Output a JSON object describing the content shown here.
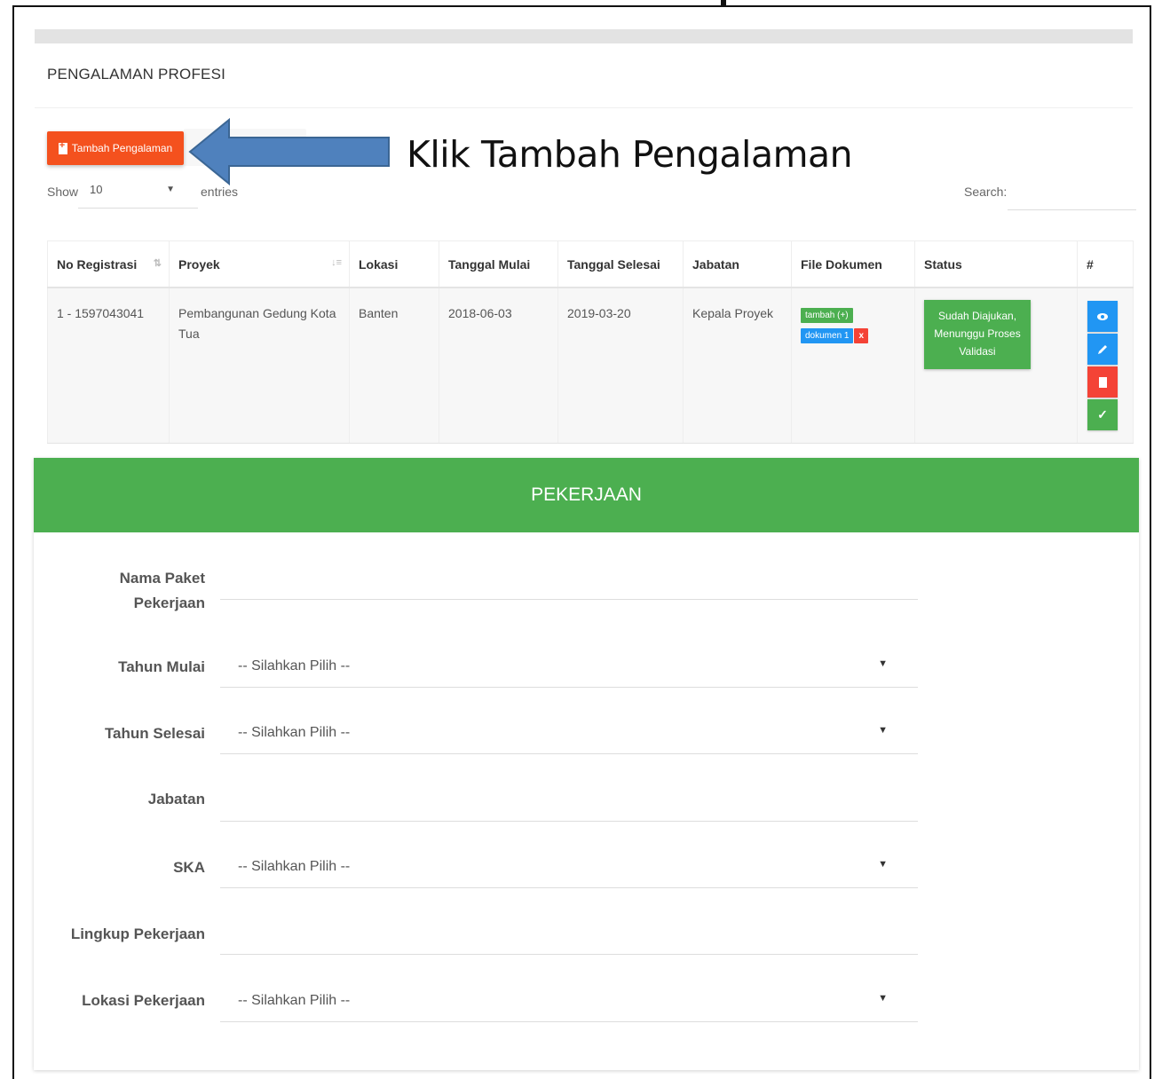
{
  "section": {
    "title": "PENGALAMAN PROFESI"
  },
  "toolbar": {
    "add_label": "Tambah Pengalaman"
  },
  "annotation": {
    "callout_text": "Klik Tambah Pengalaman",
    "arrow_color": "#4f81bd"
  },
  "table_controls": {
    "show_label": "Show",
    "show_value": "10",
    "entries_label": "entries",
    "search_label": "Search:"
  },
  "table": {
    "headers": [
      "No Registrasi",
      "Proyek",
      "Lokasi",
      "Tanggal Mulai",
      "Tanggal Selesai",
      "Jabatan",
      "File Dokumen",
      "Status",
      "#"
    ],
    "rows": [
      {
        "no_registrasi": "1 - 1597043041",
        "proyek": "Pembangunan Gedung Kota Tua",
        "lokasi": "Banten",
        "tanggal_mulai": "2018-06-03",
        "tanggal_selesai": "2019-03-20",
        "jabatan": "Kepala Proyek",
        "file_add": "tambah (+)",
        "file_doc": "dokumen 1",
        "file_remove": "x",
        "status": "Sudah Diajukan, Menunggu Proses Validasi",
        "check_glyph": "✓"
      }
    ]
  },
  "form": {
    "header": "PEKERJAAN",
    "fields": [
      {
        "label_line1": "Nama Paket",
        "label_line2": "Pekerjaan",
        "placeholder": ""
      },
      {
        "label": "Tahun Mulai",
        "placeholder": "-- Silahkan Pilih --"
      },
      {
        "label": "Tahun Selesai",
        "placeholder": "-- Silahkan Pilih --"
      },
      {
        "label": "Jabatan",
        "placeholder": ""
      },
      {
        "label": "SKA",
        "placeholder": "-- Silahkan Pilih --"
      },
      {
        "label": "Lingkup Pekerjaan",
        "placeholder": ""
      },
      {
        "label": "Lokasi Pekerjaan",
        "placeholder": "-- Silahkan Pilih --"
      }
    ]
  },
  "colors": {
    "accent_orange": "#f4511e",
    "accent_green": "#4caf50",
    "accent_blue": "#2196f3",
    "accent_red": "#f44336"
  },
  "icons": [
    "document-plus-icon",
    "sort-icon",
    "eye-icon",
    "pencil-icon",
    "trash-icon",
    "check-icon",
    "dropdown-caret-icon",
    "arrow-callout"
  ]
}
